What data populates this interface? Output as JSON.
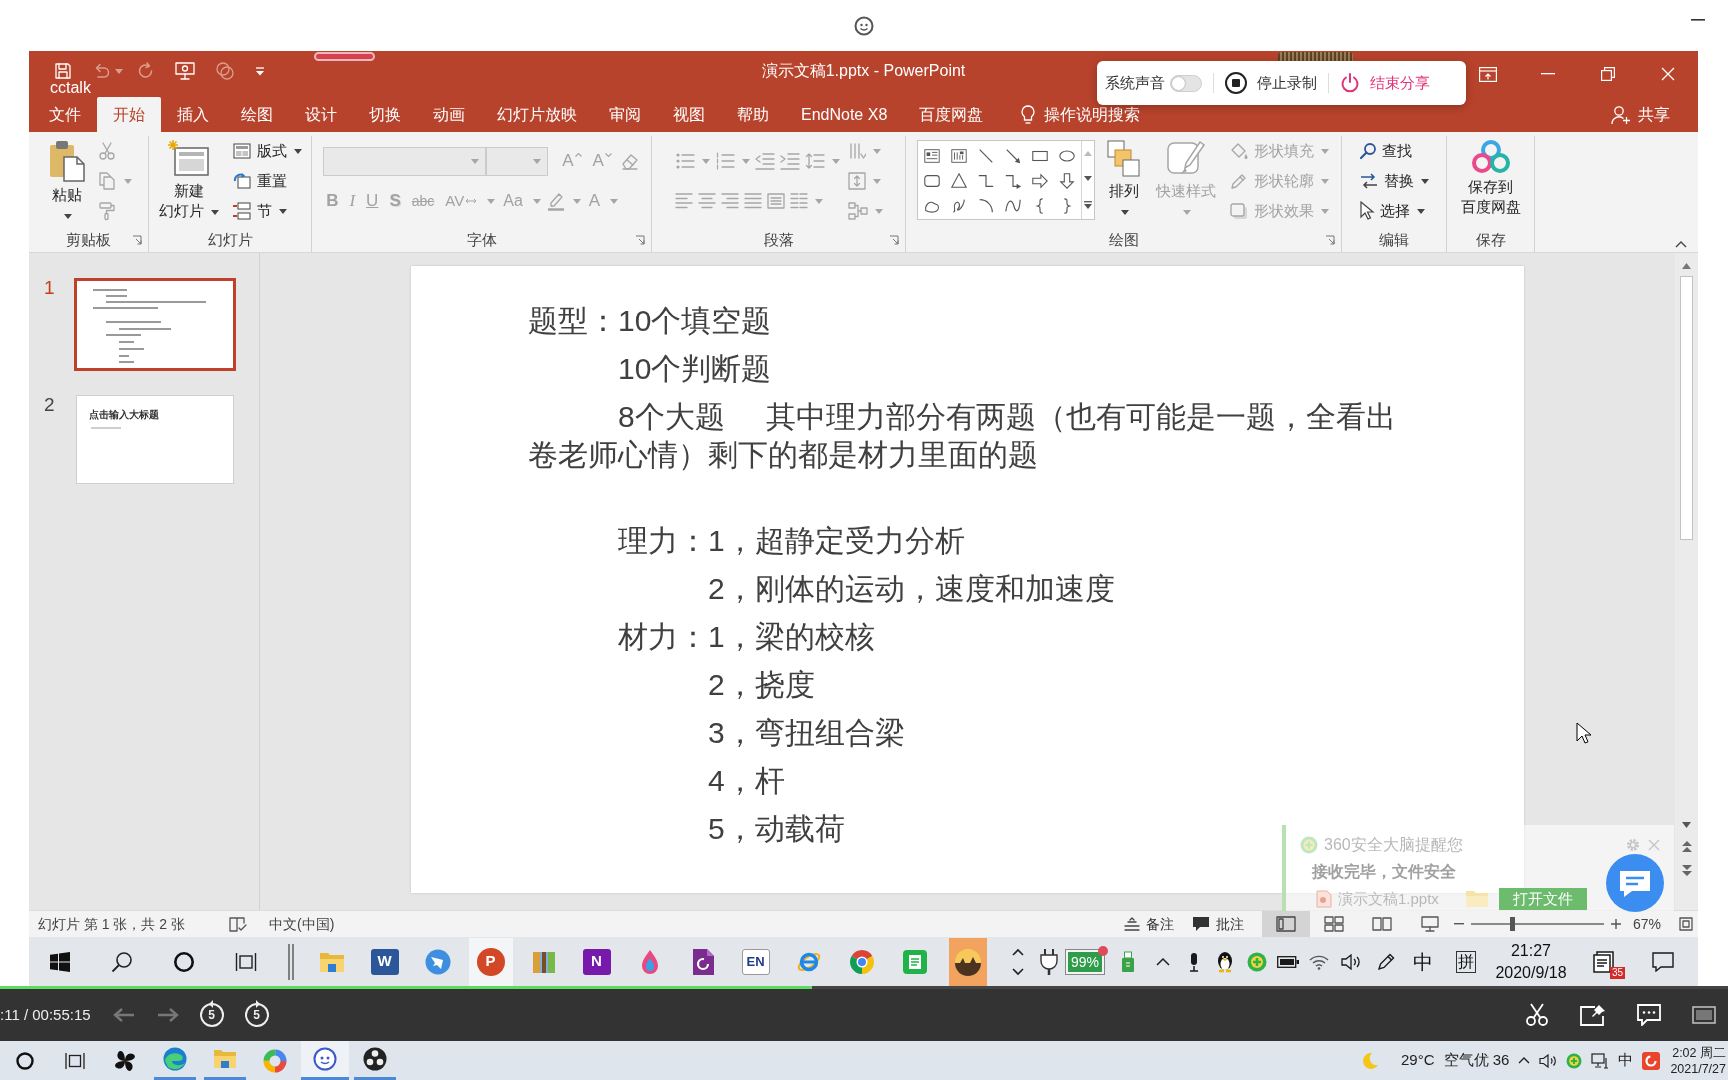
{
  "window": {
    "title": "演示文稿1.pptx - PowerPoint",
    "overlay_label": "cctalk"
  },
  "quick_access": [
    {
      "kind": "save",
      "disabled": false
    },
    {
      "kind": "undo",
      "disabled": true,
      "dropdown": true
    },
    {
      "kind": "redo",
      "disabled": true
    },
    {
      "kind": "present",
      "disabled": false
    },
    {
      "kind": "touch",
      "disabled": true
    },
    {
      "kind": "customize",
      "disabled": false
    }
  ],
  "screen_share": {
    "sound": {
      "label": "系统声音",
      "on": false
    },
    "stop": {
      "label": "停止录制"
    },
    "end": {
      "label": "结束分享"
    }
  },
  "tabs": [
    {
      "label": "文件",
      "selected": false
    },
    {
      "label": "开始",
      "selected": true
    },
    {
      "label": "插入",
      "selected": false
    },
    {
      "label": "绘图",
      "selected": false
    },
    {
      "label": "设计",
      "selected": false
    },
    {
      "label": "切换",
      "selected": false
    },
    {
      "label": "动画",
      "selected": false
    },
    {
      "label": "幻灯片放映",
      "selected": false
    },
    {
      "label": "审阅",
      "selected": false
    },
    {
      "label": "视图",
      "selected": false
    },
    {
      "label": "帮助",
      "selected": false
    },
    {
      "label": "EndNote X8",
      "selected": false
    },
    {
      "label": "百度网盘",
      "selected": false
    }
  ],
  "tell_me": {
    "label": "操作说明搜索"
  },
  "share": {
    "label": "共享"
  },
  "ribbon": {
    "groups": [
      {
        "label": "剪贴板",
        "launcher": true,
        "columns": [
          [
            [
              {
                "kind": "paste",
                "lines": [
                  "粘贴"
                ],
                "disabled": false,
                "dropdown": true
              }
            ]
          ],
          [
            [
              {
                "kind": "cut",
                "disabled": true
              }
            ],
            [
              {
                "kind": "copy",
                "disabled": true,
                "dropdown": true
              }
            ],
            [
              {
                "kind": "format-painter",
                "disabled": true
              }
            ]
          ]
        ]
      },
      {
        "label": "幻灯片",
        "columns": [
          [
            [
              {
                "kind": "new-slide",
                "lines": [
                  "新建",
                  "幻灯片"
                ],
                "disabled": false,
                "dropdown": true
              }
            ]
          ],
          [
            [
              {
                "kind": "layout",
                "label": "版式",
                "disabled": false,
                "dropdown": true
              }
            ],
            [
              {
                "kind": "reset",
                "label": "重置",
                "disabled": false
              }
            ],
            [
              {
                "kind": "section",
                "label": "节",
                "disabled": false,
                "dropdown": true
              }
            ]
          ]
        ]
      },
      {
        "label": "字体",
        "launcher": true,
        "columns": [
          [
            [
              {
                "kind": "font-name",
                "disabled": true,
                "dropdown": true
              },
              {
                "kind": "font-size",
                "disabled": true,
                "dropdown": true
              },
              {
                "kind": "grow-font",
                "label": "A",
                "disabled": true
              },
              {
                "kind": "shrink-font",
                "label": "A",
                "disabled": true
              },
              {
                "kind": "clear-format",
                "disabled": true
              }
            ],
            [
              {
                "kind": "bold",
                "label": "B",
                "disabled": true
              },
              {
                "kind": "italic",
                "label": "I",
                "disabled": true
              },
              {
                "kind": "underline",
                "label": "U",
                "disabled": true
              },
              {
                "kind": "text-shadow",
                "label": "S",
                "disabled": true
              },
              {
                "kind": "strikethrough",
                "label": "abc",
                "disabled": true
              },
              {
                "kind": "char-spacing",
                "label": "AV",
                "disabled": true,
                "dropdown": true
              },
              {
                "kind": "change-case",
                "label": "Aa",
                "disabled": true,
                "dropdown": true
              },
              {
                "kind": "highlight",
                "disabled": true,
                "dropdown": true
              },
              {
                "kind": "font-color",
                "label": "A",
                "disabled": true,
                "dropdown": true
              }
            ]
          ]
        ]
      },
      {
        "label": "段落",
        "launcher": true,
        "columns": [
          [
            [
              {
                "kind": "bullets",
                "disabled": true,
                "dropdown": true
              },
              {
                "kind": "numbering",
                "disabled": true,
                "dropdown": true
              },
              {
                "kind": "outdent",
                "disabled": true
              },
              {
                "kind": "indent",
                "disabled": true
              },
              {
                "kind": "line-spacing",
                "disabled": true,
                "dropdown": true
              }
            ],
            [
              {
                "kind": "align-left",
                "disabled": true
              },
              {
                "kind": "align-center",
                "disabled": true
              },
              {
                "kind": "align-right",
                "disabled": true
              },
              {
                "kind": "justify",
                "disabled": true
              },
              {
                "kind": "distributed",
                "disabled": true
              },
              {
                "kind": "columns",
                "disabled": true,
                "dropdown": true
              }
            ]
          ],
          [
            [
              {
                "kind": "text-direction",
                "disabled": true,
                "dropdown": true
              }
            ],
            [
              {
                "kind": "align-text",
                "disabled": true,
                "dropdown": true
              }
            ],
            [
              {
                "kind": "smartart",
                "disabled": true,
                "dropdown": true
              }
            ]
          ]
        ]
      },
      {
        "label": "绘图",
        "launcher": true,
        "columns": [
          [
            [
              {
                "kind": "shape-gallery",
                "disabled": false
              }
            ]
          ],
          [
            [
              {
                "kind": "arrange",
                "lines": [
                  "排列"
                ],
                "disabled": false,
                "dropdown": true
              }
            ]
          ],
          [
            [
              {
                "kind": "quick-styles",
                "lines": [
                  "快速样式"
                ],
                "disabled": true,
                "dropdown": true
              }
            ]
          ],
          [
            [
              {
                "kind": "shape-fill",
                "label": "形状填充",
                "disabled": true,
                "dropdown": true
              }
            ],
            [
              {
                "kind": "shape-outline",
                "label": "形状轮廓",
                "disabled": true,
                "dropdown": true
              }
            ],
            [
              {
                "kind": "shape-effects",
                "label": "形状效果",
                "disabled": true,
                "dropdown": true
              }
            ]
          ]
        ]
      },
      {
        "label": "编辑",
        "columns": [
          [
            [
              {
                "kind": "find",
                "label": "查找",
                "disabled": false
              }
            ],
            [
              {
                "kind": "replace",
                "label": "替换",
                "disabled": false,
                "dropdown": true
              }
            ],
            [
              {
                "kind": "select",
                "label": "选择",
                "disabled": false,
                "dropdown": true
              }
            ]
          ]
        ]
      },
      {
        "label": "保存",
        "columns": [
          [
            [
              {
                "kind": "save-cloud",
                "lines": [
                  "保存到",
                  "百度网盘"
                ],
                "disabled": false
              }
            ]
          ]
        ]
      }
    ]
  },
  "slides": [
    {
      "number": "1",
      "selected": true,
      "kind": "content"
    },
    {
      "number": "2",
      "selected": false,
      "kind": "title",
      "title": "点击输入大标题"
    }
  ],
  "slide": {
    "sections": [
      {
        "kind": "outer",
        "label": "题型：",
        "items": [
          "10个填空题",
          "10个判断题",
          "8个大题     其中理力部分有两题（也有可能是一题，全看出卷老师心情）剩下的都是材力里面的题"
        ]
      },
      {
        "kind": "inner",
        "space_before": true,
        "label": "理力：",
        "items": [
          "1，超静定受力分析",
          "2，刚体的运动，速度和加速度"
        ]
      },
      {
        "kind": "inner",
        "label": "材力：",
        "items": [
          "1，梁的校核",
          "2，挠度",
          "3，弯扭组合梁",
          "4，杆",
          "5，动载荷"
        ]
      }
    ]
  },
  "status_bar": {
    "slide_info": "幻灯片 第 1 张，共 2 张",
    "language": "中文(中国)",
    "notes": "备注",
    "comments": "批注",
    "views": [
      {
        "kind": "normal",
        "selected": true
      },
      {
        "kind": "sorter",
        "selected": false
      },
      {
        "kind": "reading",
        "selected": false
      },
      {
        "kind": "slideshow",
        "selected": false
      }
    ],
    "zoom": {
      "level": 0.31,
      "reading": "67%"
    }
  },
  "notification": {
    "title": "360安全大脑提醒您",
    "message": "接收完毕，文件安全",
    "file": "演示文稿1.pptx",
    "button": "打开文件"
  },
  "taskbar": {
    "apps": [
      {
        "kind": "explorer",
        "active": false,
        "attention": false
      },
      {
        "kind": "word",
        "logo": "W",
        "active": false,
        "attention": false
      },
      {
        "kind": "bird",
        "active": false,
        "attention": false
      },
      {
        "kind": "powerpoint",
        "logo": "P",
        "active": true,
        "attention": false
      },
      {
        "kind": "archive",
        "active": false,
        "attention": false
      },
      {
        "kind": "onenote",
        "logo": "N",
        "active": false,
        "attention": false
      },
      {
        "kind": "drop",
        "active": false,
        "attention": false
      },
      {
        "kind": "pdf",
        "active": false,
        "attention": false
      },
      {
        "kind": "endnote",
        "logo": "EN",
        "active": false,
        "attention": false
      },
      {
        "kind": "ie",
        "active": false,
        "attention": false
      },
      {
        "kind": "chrome",
        "active": false,
        "attention": false
      },
      {
        "kind": "notes",
        "active": false,
        "attention": false
      },
      {
        "kind": "photo",
        "active": false,
        "attention": true
      }
    ],
    "battery": "99%",
    "ime": "中",
    "input_mode": "拼",
    "time": "21:27",
    "date": "2020/9/18",
    "notification_count": "35"
  },
  "player": {
    "time": ":11 / 00:55:15",
    "progress": {
      "level": 0.47
    },
    "nav": [
      {
        "kind": "back",
        "disabled": true
      },
      {
        "kind": "forward",
        "disabled": true
      }
    ],
    "jumps": [
      {
        "kind": "rewind",
        "label": "5"
      },
      {
        "kind": "skip",
        "label": "5"
      }
    ]
  },
  "system_taskbar": {
    "buttons": [
      {
        "kind": "cortana",
        "running": false,
        "active": false
      },
      {
        "kind": "task-view",
        "running": false,
        "active": false
      },
      {
        "kind": "pinwheel",
        "running": false,
        "active": false
      },
      {
        "kind": "edge",
        "running": true,
        "active": false
      },
      {
        "kind": "explorer",
        "running": true,
        "active": false
      },
      {
        "kind": "color-ring",
        "running": false,
        "active": false
      },
      {
        "kind": "cctalk",
        "running": true,
        "active": true
      },
      {
        "kind": "obs",
        "running": true,
        "active": false
      }
    ],
    "weather": {
      "temperature": "29°C",
      "air": "空气优 36"
    },
    "ime": "中",
    "time": "2:02 周二",
    "date": "2021/7/27"
  }
}
